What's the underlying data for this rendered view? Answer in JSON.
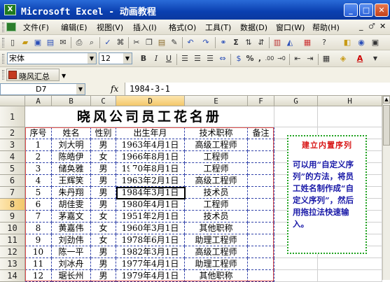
{
  "window": {
    "title": "Microsoft Excel - 动画教程",
    "app_icon": "X",
    "controls": [
      "_",
      "□",
      "✕"
    ]
  },
  "menu": {
    "items": [
      "文件(F)",
      "编辑(E)",
      "视图(V)",
      "插入(I)",
      "格式(O)",
      "工具(T)",
      "数据(D)",
      "窗口(W)",
      "帮助(H)"
    ],
    "doc_controls": [
      "_",
      "♂",
      "✕"
    ]
  },
  "format": {
    "font": "宋体",
    "size": "12",
    "bold": "B",
    "italic": "I",
    "underline": "U",
    "percent": "%",
    "comma": ",",
    "inc_dec": ".00",
    "currency": "→0",
    "color_a": "A"
  },
  "macro_bar": {
    "button_label": "晓风汇总"
  },
  "formula_bar": {
    "name_box": "D7",
    "fx": "fx",
    "value": "1984-3-1"
  },
  "columns": [
    "A",
    "B",
    "C",
    "D",
    "E",
    "F",
    "G",
    "H"
  ],
  "rows": [
    "1",
    "2",
    "3",
    "4",
    "5",
    "6",
    "7",
    "8",
    "9",
    "10",
    "11",
    "12",
    "13",
    "14"
  ],
  "sheet_title": "晓风公司员工花名册",
  "headers": [
    "序号",
    "姓名",
    "性别",
    "出生年月",
    "技术职称",
    "备注"
  ],
  "records": [
    [
      "1",
      "刘大明",
      "男",
      "1963年4月1日",
      "高级工程师",
      ""
    ],
    [
      "2",
      "陈皓伊",
      "女",
      "1966年8月1日",
      "工程师",
      ""
    ],
    [
      "3",
      "储奂雅",
      "男",
      "1970年8月1日",
      "工程师",
      ""
    ],
    [
      "4",
      "王辉笑",
      "男",
      "1963年2月1日",
      "高级工程师",
      ""
    ],
    [
      "5",
      "朱丹翔",
      "男",
      "1984年3月1日",
      "技术员",
      ""
    ],
    [
      "6",
      "胡佳雯",
      "男",
      "1980年4月1日",
      "工程师",
      ""
    ],
    [
      "7",
      "茅嘉文",
      "女",
      "1951年2月1日",
      "技术员",
      ""
    ],
    [
      "8",
      "黄嘉伟",
      "女",
      "1960年3月1日",
      "其他职称",
      ""
    ],
    [
      "9",
      "刘劲伟",
      "女",
      "1978年6月1日",
      "助理工程师",
      ""
    ],
    [
      "10",
      "陈一平",
      "男",
      "1982年3月1日",
      "高级工程师",
      ""
    ],
    [
      "11",
      "刘冰舟",
      "男",
      "1977年4月1日",
      "助理工程师",
      ""
    ],
    [
      "12",
      "琚长州",
      "男",
      "1979年4月1日",
      "其他职称",
      ""
    ]
  ],
  "annotation": {
    "title": "建立内置序列",
    "body": "可以用“自定义序列”的方法，将员工姓名制作成“自定义序列”，然后用拖拉法快速输入。"
  },
  "colors": {
    "title_blue": "#0a3fb0",
    "annotation_red": "#d81818",
    "annotation_blue": "#1a1aa8",
    "annotation_border": "#21a321",
    "selection": "#000000"
  }
}
